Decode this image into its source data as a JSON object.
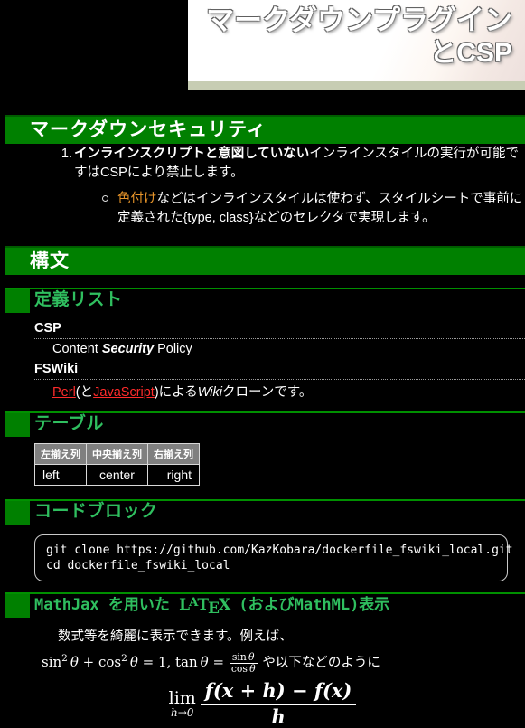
{
  "banner": {
    "line1": "マークダウンプラグイン",
    "line2": "とCSP",
    "accent_bar_color": "#c7cdb3"
  },
  "colors": {
    "green": "#008000",
    "green_text": "#2fbf5f",
    "orange": "#e8952a",
    "link_red": "#ff2b2b",
    "table_header_bg": "#808080",
    "page_bg": "#000000"
  },
  "sections": {
    "security": {
      "heading": "マークダウンセキュリティ",
      "ordered_items": [
        {
          "marker": "1.",
          "bold_part": "インラインスクリプトと意図していない",
          "rest": "インラインスタイルの実行が可能ですはCSPにより禁止します。"
        }
      ],
      "unordered_items": [
        {
          "highlight": "色付け",
          "rest": "などはインラインスタイルは使わず、スタイルシートで事前に定義された{type, class}などのセレクタで実現します。"
        }
      ]
    },
    "syntax": {
      "heading": "構文"
    },
    "definition_list": {
      "heading": "定義リスト",
      "entries": [
        {
          "term": "CSP",
          "def_pre": "Content ",
          "def_em": "Security",
          "def_post": " Policy"
        },
        {
          "term": "FSWiki",
          "link1": "Perl",
          "mid1": "(と",
          "link2": "JavaScript",
          "mid2": ")による",
          "em": "Wiki",
          "tail": "クローンです。"
        }
      ]
    },
    "table": {
      "heading": "テーブル",
      "columns": [
        "左揃え列",
        "中央揃え列",
        "右揃え列"
      ],
      "rows": [
        [
          "left",
          "center",
          "right"
        ]
      ]
    },
    "codeblock": {
      "heading": "コードブロック",
      "lines": [
        "git clone https://github.com/KazKobara/dockerfile_fswiki_local.git",
        "cd dockerfile_fswiki_local"
      ]
    },
    "mathjax": {
      "heading_pre": "MathJax を用いた ",
      "heading_latex": "LATEX",
      "heading_post": " (およびMathML)表示",
      "paragraph_pre": "数式等を綺麗に表示できます。例えば、",
      "inline_math": "sin²θ + cos²θ = 1, tanθ = sinθ/cosθ",
      "paragraph_mid": "や以下などのように",
      "display_math": "lim h→0 ( f(x+h) − f(x) ) / h",
      "display_lim": "lim",
      "display_lim_sub": "h→0",
      "display_numerator": "f(x + h) − f(x)",
      "display_denominator": "h"
    }
  }
}
